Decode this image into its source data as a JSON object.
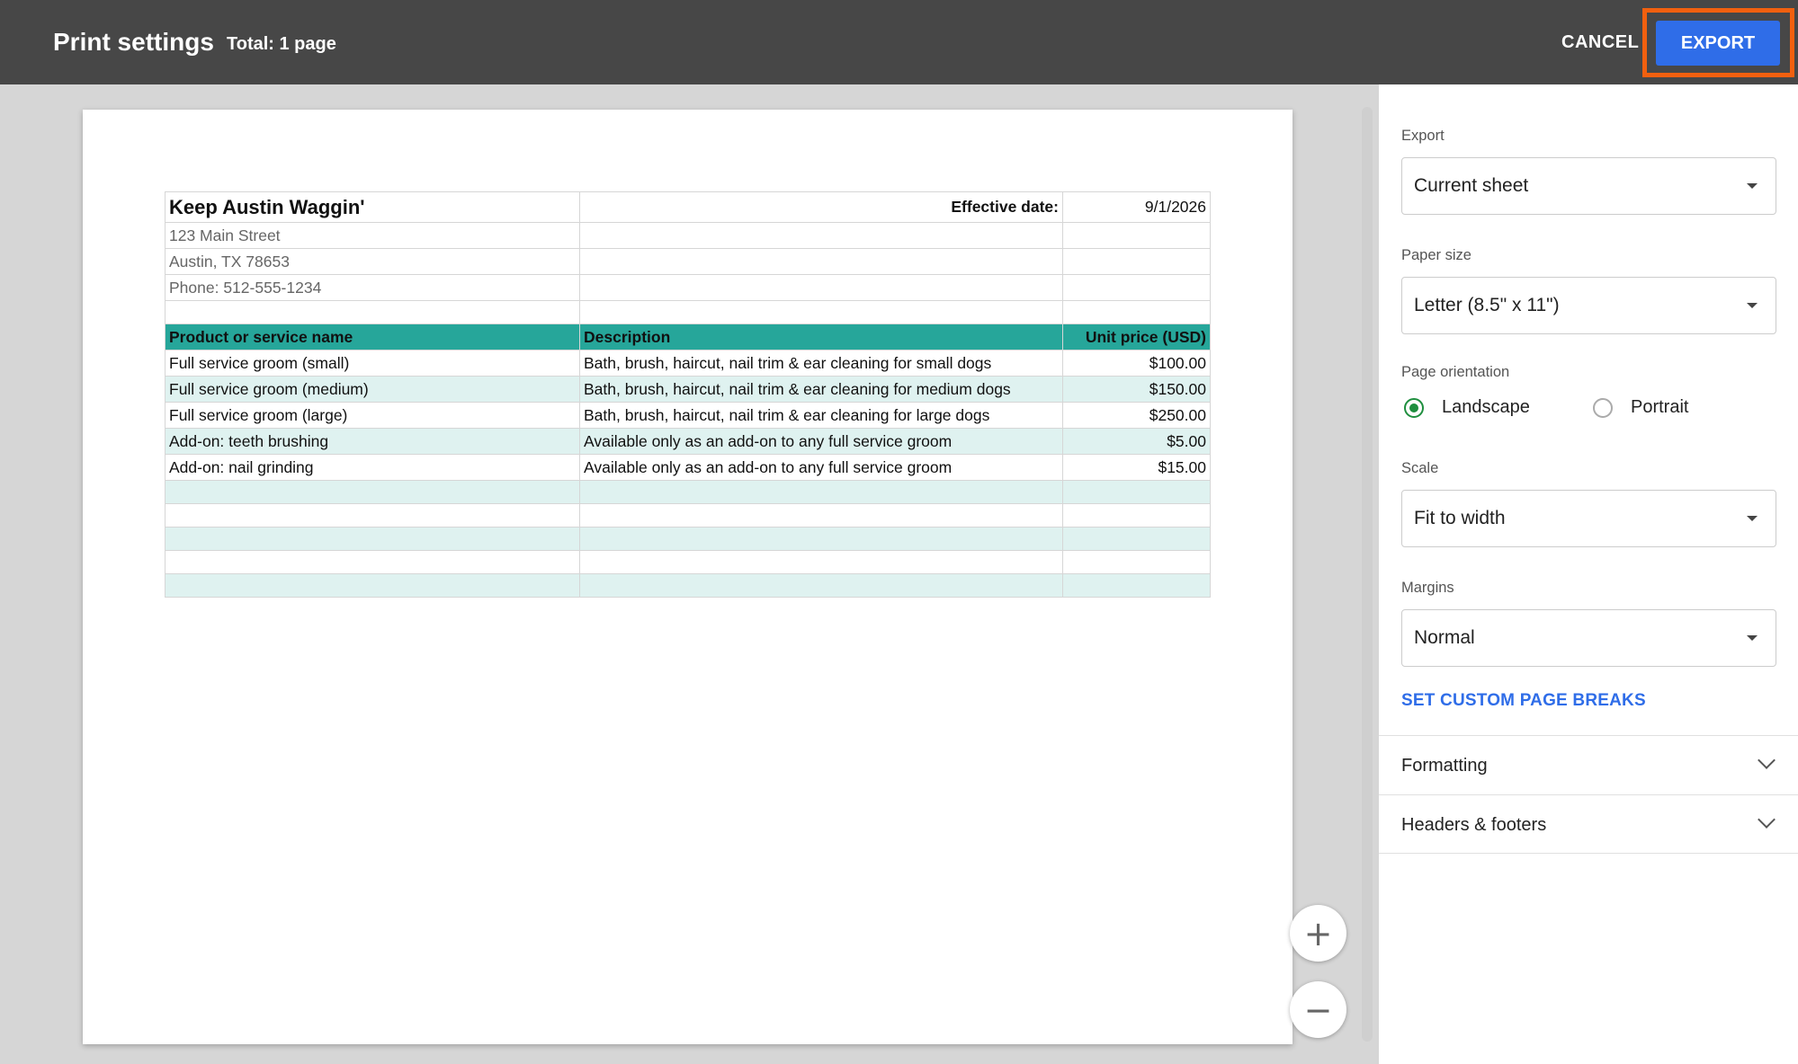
{
  "header": {
    "title": "Print settings",
    "total": "Total: 1 page",
    "cancel_label": "CANCEL",
    "export_label": "EXPORT",
    "accent_color": "#2f6de8",
    "highlight_color": "#f2600f"
  },
  "preview": {
    "company": "Keep Austin Waggin'",
    "effective_label": "Effective date:",
    "effective_date": "9/1/2026",
    "address1": "123 Main Street",
    "address2": "Austin, TX  78653",
    "phone": "Phone: 512-555-1234",
    "columns": [
      "Product or service name",
      "Description",
      "Unit price (USD)"
    ],
    "rows": [
      [
        "Full service groom (small)",
        "Bath, brush, haircut, nail trim & ear cleaning for small dogs",
        "$100.00"
      ],
      [
        "Full service groom (medium)",
        "Bath, brush, haircut, nail trim & ear cleaning for medium dogs",
        "$150.00"
      ],
      [
        "Full service groom (large)",
        "Bath, brush, haircut, nail trim & ear cleaning for large dogs",
        "$250.00"
      ],
      [
        "Add-on: teeth brushing",
        "Available only as an add-on to any full service groom",
        "$5.00"
      ],
      [
        "Add-on: nail grinding",
        "Available only as an add-on to any full service groom",
        "$15.00"
      ]
    ],
    "header_color": "#26a69a",
    "band_color": "#dff2f0"
  },
  "zoom": {
    "in_icon": "plus-icon",
    "out_icon": "minus-icon"
  },
  "panel": {
    "export": {
      "label": "Export",
      "value": "Current sheet"
    },
    "paper_size": {
      "label": "Paper size",
      "value": "Letter (8.5\" x 11\")"
    },
    "orientation": {
      "label": "Page orientation",
      "landscape": "Landscape",
      "portrait": "Portrait",
      "selected": "Landscape"
    },
    "scale": {
      "label": "Scale",
      "value": "Fit to width"
    },
    "margins": {
      "label": "Margins",
      "value": "Normal"
    },
    "custom_breaks": "SET CUSTOM PAGE BREAKS",
    "formatting": "Formatting",
    "headers_footers": "Headers & footers"
  }
}
